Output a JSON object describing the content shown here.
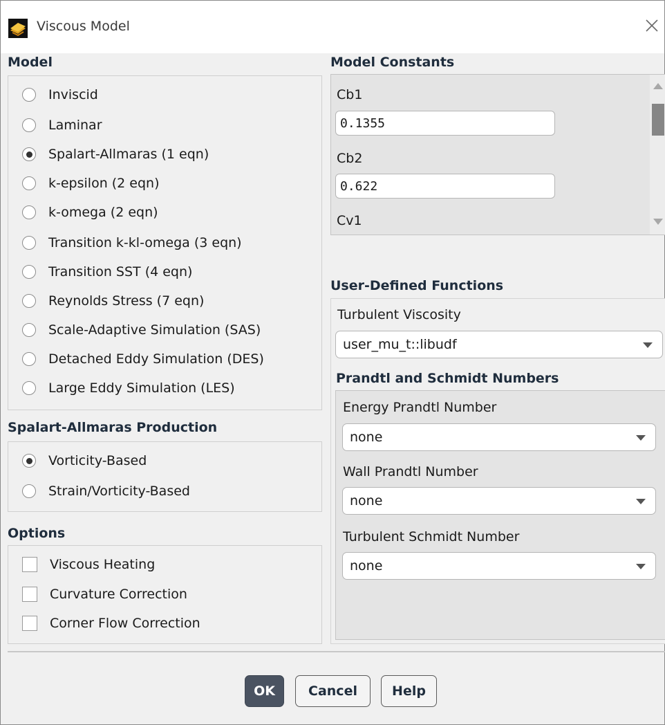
{
  "window": {
    "title": "Viscous Model",
    "icon": "fluent-app-icon",
    "close_icon": "close-icon"
  },
  "model": {
    "heading": "Model",
    "options": [
      {
        "label": "Inviscid",
        "selected": false
      },
      {
        "label": "Laminar",
        "selected": false
      },
      {
        "label": "Spalart-Allmaras (1 eqn)",
        "selected": true
      },
      {
        "label": "k-epsilon (2 eqn)",
        "selected": false
      },
      {
        "label": "k-omega (2 eqn)",
        "selected": false
      },
      {
        "label": "Transition k-kl-omega (3 eqn)",
        "selected": false
      },
      {
        "label": "Transition SST (4 eqn)",
        "selected": false
      },
      {
        "label": "Reynolds Stress (7 eqn)",
        "selected": false
      },
      {
        "label": "Scale-Adaptive Simulation (SAS)",
        "selected": false
      },
      {
        "label": "Detached Eddy Simulation (DES)",
        "selected": false
      },
      {
        "label": "Large Eddy Simulation (LES)",
        "selected": false
      }
    ]
  },
  "production": {
    "heading": "Spalart-Allmaras Production",
    "options": [
      {
        "label": "Vorticity-Based",
        "selected": true
      },
      {
        "label": "Strain/Vorticity-Based",
        "selected": false
      }
    ]
  },
  "options": {
    "heading": "Options",
    "items": [
      {
        "label": "Viscous Heating",
        "checked": false
      },
      {
        "label": "Curvature Correction",
        "checked": false
      },
      {
        "label": "Corner Flow Correction",
        "checked": false
      }
    ]
  },
  "constants": {
    "heading": "Model Constants",
    "items": [
      {
        "label": "Cb1",
        "value": "0.1355"
      },
      {
        "label": "Cb2",
        "value": "0.622"
      },
      {
        "label": "Cv1",
        "value": ""
      }
    ]
  },
  "udf": {
    "heading": "User-Defined Functions",
    "turb_visc_label": "Turbulent Viscosity",
    "turb_visc_value": "user_mu_t::libudf"
  },
  "prandtl": {
    "heading": "Prandtl and Schmidt Numbers",
    "fields": [
      {
        "label": "Energy Prandtl Number",
        "value": "none"
      },
      {
        "label": "Wall Prandtl Number",
        "value": "none"
      },
      {
        "label": "Turbulent Schmidt Number",
        "value": "none"
      }
    ]
  },
  "buttons": {
    "ok": "OK",
    "cancel": "Cancel",
    "help": "Help"
  },
  "colors": {
    "primary_button": "#4a5361",
    "panel_bg": "#e4e4e4",
    "window_bg": "#f0f0f0"
  }
}
